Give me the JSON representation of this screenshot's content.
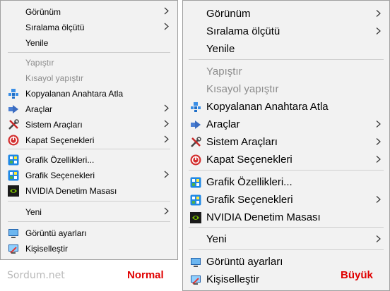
{
  "menus": {
    "normal": {
      "items": [
        {
          "label": "Görünüm",
          "submenu": true
        },
        {
          "label": "Sıralama ölçütü",
          "submenu": true
        },
        {
          "label": "Yenile"
        },
        {
          "label": "Yapıştır",
          "disabled": true
        },
        {
          "label": "Kısayol yapıştır",
          "disabled": true
        },
        {
          "label": "Kopyalanan Anahtara Atla",
          "icon": "registry-icon"
        },
        {
          "label": "Araçlar",
          "submenu": true,
          "icon": "tools-arrow-icon"
        },
        {
          "label": "Sistem Araçları",
          "submenu": true,
          "icon": "system-tools-icon"
        },
        {
          "label": "Kapat Seçenekleri",
          "submenu": true,
          "icon": "power-icon"
        },
        {
          "label": "Grafik Özellikleri...",
          "icon": "graphics-icon"
        },
        {
          "label": "Grafik Seçenekleri",
          "submenu": true,
          "icon": "graphics-icon"
        },
        {
          "label": "NVIDIA Denetim Masası",
          "icon": "nvidia-icon"
        },
        {
          "label": "Yeni",
          "submenu": true
        },
        {
          "label": "Görüntü ayarları",
          "icon": "display-icon"
        },
        {
          "label": "Kişiselleştir",
          "icon": "personalize-icon"
        }
      ]
    },
    "large": {
      "items": [
        {
          "label": "Görünüm",
          "submenu": true
        },
        {
          "label": "Sıralama ölçütü",
          "submenu": true
        },
        {
          "label": "Yenile"
        },
        {
          "label": "Yapıştır",
          "disabled": true
        },
        {
          "label": "Kısayol yapıştır",
          "disabled": true
        },
        {
          "label": "Kopyalanan Anahtara Atla",
          "icon": "registry-icon"
        },
        {
          "label": "Araçlar",
          "submenu": true,
          "icon": "tools-arrow-icon"
        },
        {
          "label": "Sistem Araçları",
          "submenu": true,
          "icon": "system-tools-icon"
        },
        {
          "label": "Kapat Seçenekleri",
          "submenu": true,
          "icon": "power-icon"
        },
        {
          "label": "Grafik Özellikleri...",
          "icon": "graphics-icon"
        },
        {
          "label": "Grafik Seçenekleri",
          "submenu": true,
          "icon": "graphics-icon"
        },
        {
          "label": "NVIDIA Denetim Masası",
          "icon": "nvidia-icon"
        },
        {
          "label": "Yeni",
          "submenu": true
        },
        {
          "label": "Görüntü ayarları",
          "icon": "display-icon"
        },
        {
          "label": "Kişiselleştir",
          "icon": "personalize-icon"
        }
      ]
    }
  },
  "captions": {
    "site": "Sordum.net",
    "normal": "Normal",
    "large": "Büyük"
  },
  "colors": {
    "menu_background": "#f2f2f2",
    "caption_red": "#e00000",
    "disabled_text": "#8c8c8c"
  }
}
